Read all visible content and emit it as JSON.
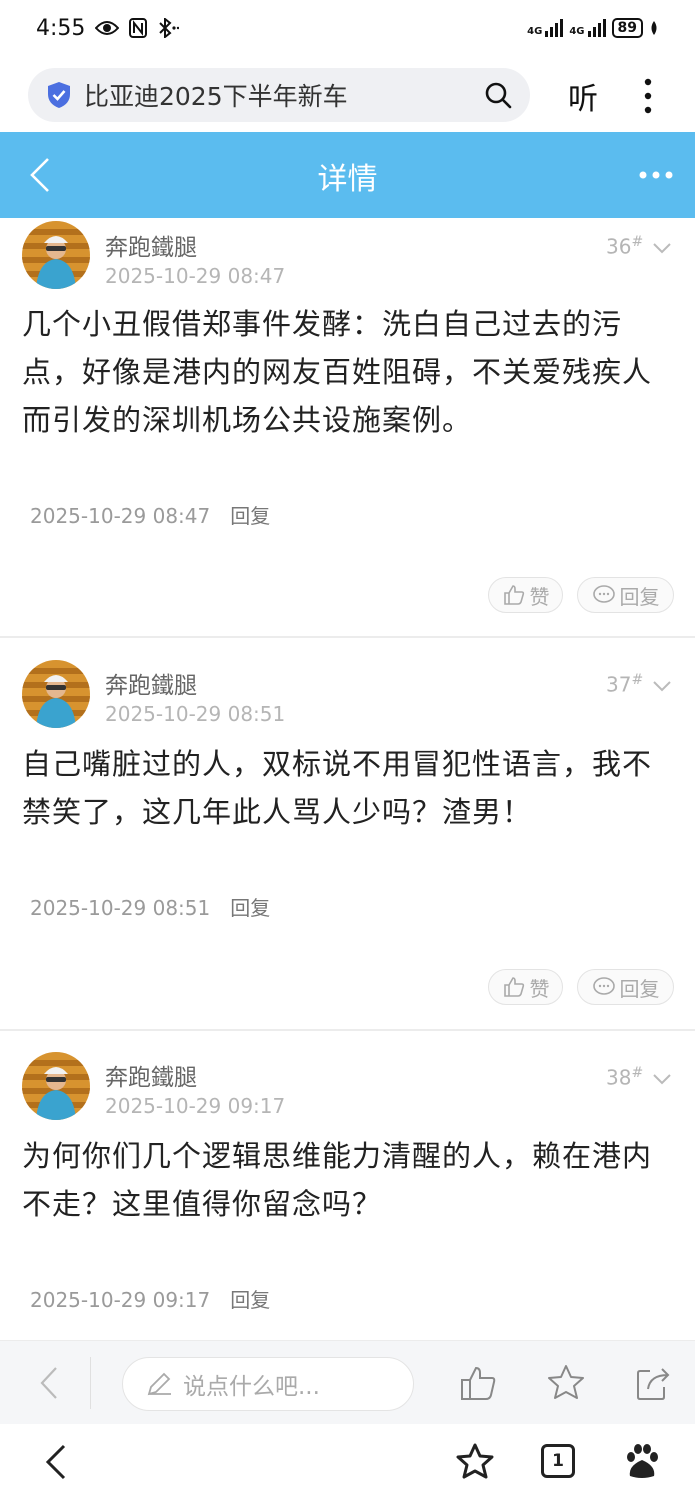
{
  "status_bar": {
    "time": "4:55",
    "battery": "89",
    "sig1": "4G",
    "sig2": "4G"
  },
  "browser": {
    "search_text": "比亚迪2025下半年新车",
    "listen_label": "听"
  },
  "header": {
    "title": "详情",
    "accent": "#5bbcef"
  },
  "comments": [
    {
      "user": "奔跑鐵腿",
      "time": "2025-10-29 08:47",
      "floor": "36",
      "floor_mark": "#",
      "text": "几个小丑假借郑事件发酵：洗白自己过去的污点，好像是港内的网友百姓阻碍，不关爱残疾人而引发的深圳机场公共设施案例。",
      "meta_time": "2025-10-29 08:47",
      "reply_link": "回复",
      "like_label": "赞",
      "reply_label": "回复"
    },
    {
      "user": "奔跑鐵腿",
      "time": "2025-10-29 08:51",
      "floor": "37",
      "floor_mark": "#",
      "text": "自己嘴脏过的人，双标说不用冒犯性语言，我不禁笑了，这几年此人骂人少吗？渣男！",
      "meta_time": "2025-10-29 08:51",
      "reply_link": "回复",
      "like_label": "赞",
      "reply_label": "回复"
    },
    {
      "user": "奔跑鐵腿",
      "time": "2025-10-29 09:17",
      "floor": "38",
      "floor_mark": "#",
      "text": "为何你们几个逻辑思维能力清醒的人，赖在港内不走？这里值得你留念吗？",
      "meta_time": "2025-10-29 09:17",
      "reply_link": "回复"
    }
  ],
  "comment_bar": {
    "placeholder": "说点什么吧..."
  },
  "navbar": {
    "tab_count": "1"
  }
}
